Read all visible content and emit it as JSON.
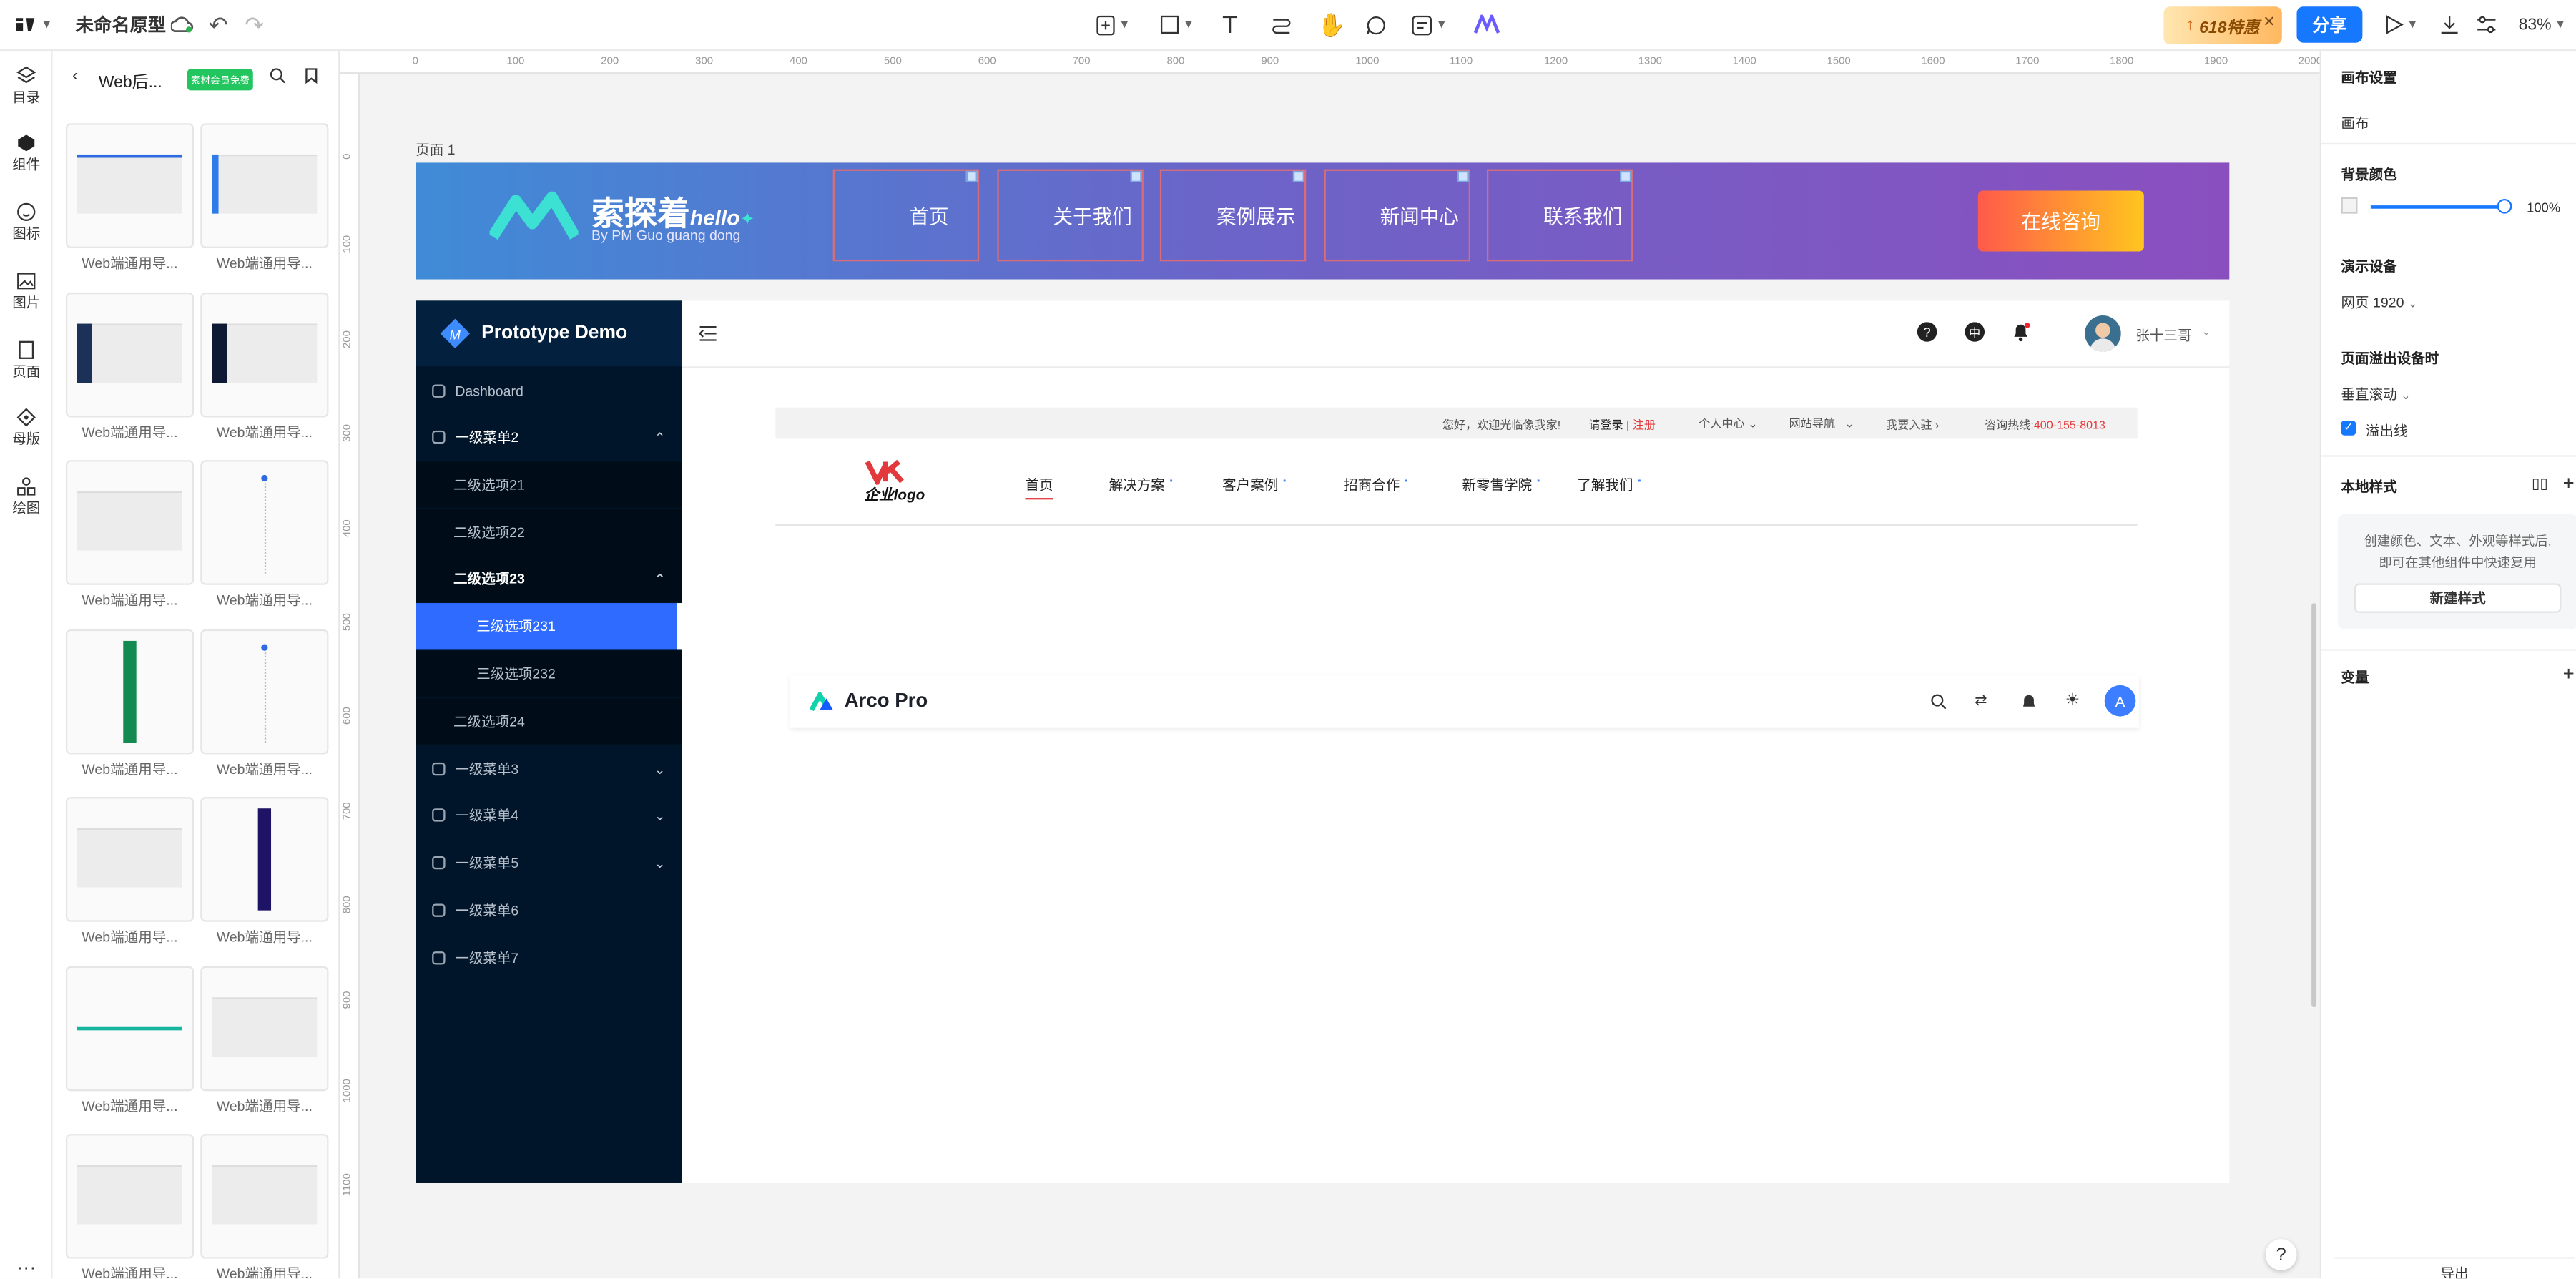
{
  "app": {
    "doc_title": "未命名原型",
    "share": "分享",
    "zoom": "83%",
    "promo": "618特惠"
  },
  "rail": [
    {
      "label": "目录"
    },
    {
      "label": "组件"
    },
    {
      "label": "图标"
    },
    {
      "label": "图片"
    },
    {
      "label": "页面"
    },
    {
      "label": "母版"
    },
    {
      "label": "绘图"
    }
  ],
  "library": {
    "title": "Web后...",
    "badge": "素材会员免费",
    "card_caption": "Web端通用导...",
    "cards": [
      {
        "caption": "Web端通用导..."
      },
      {
        "caption": "Web端通用导..."
      },
      {
        "caption": "Web端通用导..."
      },
      {
        "caption": "Web端通用导..."
      },
      {
        "caption": "Web端通用导..."
      },
      {
        "caption": "Web端通用导..."
      },
      {
        "caption": "Web端通用导..."
      },
      {
        "caption": "Web端通用导..."
      },
      {
        "caption": "Web端通用导..."
      },
      {
        "caption": "Web端通用导..."
      },
      {
        "caption": "Web端通用导..."
      },
      {
        "caption": "Web端通用导..."
      },
      {
        "caption": "Web端通用导..."
      },
      {
        "caption": "Web端通用导..."
      }
    ]
  },
  "ruler": {
    "h": [
      "0",
      "100",
      "200",
      "300",
      "400",
      "500",
      "600",
      "700",
      "800",
      "900",
      "1000",
      "1100",
      "1200",
      "1300",
      "1400",
      "1500",
      "1600",
      "1700",
      "1800",
      "1900",
      "2000"
    ],
    "v": [
      "0",
      "100",
      "200",
      "300",
      "400",
      "500",
      "600",
      "700",
      "800",
      "900",
      "1000",
      "1100"
    ]
  },
  "canvas": {
    "page_label": "页面 1"
  },
  "banner": {
    "brand": "索探着",
    "brand_hello": "hello",
    "brand_sub": "By PM Guo guang dong",
    "nav": [
      "首页",
      "关于我们",
      "案例展示",
      "新闻中心",
      "联系我们"
    ],
    "cta": "在线咨询"
  },
  "admin": {
    "brand": "Prototype Demo",
    "user": "张十三哥",
    "menu": [
      {
        "label": "Dashboard"
      },
      {
        "label": "一级菜单2"
      },
      {
        "label": "二级选项21"
      },
      {
        "label": "二级选项22"
      },
      {
        "label": "二级选项23"
      },
      {
        "label": "三级选项231"
      },
      {
        "label": "三级选项232"
      },
      {
        "label": "二级选项24"
      },
      {
        "label": "一级菜单3"
      },
      {
        "label": "一级菜单4"
      },
      {
        "label": "一级菜单5"
      },
      {
        "label": "一级菜单6"
      },
      {
        "label": "一级菜单7"
      }
    ]
  },
  "ecom": {
    "welcome": "您好，欢迎光临像我家!",
    "login": "请登录",
    "sep": "|",
    "register": "注册",
    "center": "个人中心",
    "sitenav": "网站导航",
    "join": "我要入驻",
    "hotline_label": "咨询热线:",
    "hotline": "400-155-8013",
    "logo_text": "企业logo",
    "nav": [
      "首页",
      "解决方案",
      "客户案例",
      "招商合作",
      "新零售学院",
      "了解我们"
    ]
  },
  "arco": {
    "title": "Arco Pro",
    "avatar": "A"
  },
  "right": {
    "canvas_settings": "画布设置",
    "canvas": "画布",
    "bg_color": "背景颜色",
    "opacity": "100%",
    "device": "演示设备",
    "device_val": "网页 1920",
    "overflow": "页面溢出设备时",
    "overflow_val": "垂直滚动",
    "overflow_line": "溢出线",
    "local_styles": "本地样式",
    "styles_desc1": "创建颜色、文本、外观等样式后,",
    "styles_desc2": "即可在其他组件中快速复用",
    "new_style": "新建样式",
    "variables": "变量",
    "export": "导出"
  },
  "help": "?",
  "colors": {
    "accent": "#1677ff",
    "share_btn": "#1677ff",
    "cta_from": "#ff5a4a",
    "cta_to": "#ffc51f",
    "sidebar": "#001529",
    "active": "#1677ff"
  }
}
